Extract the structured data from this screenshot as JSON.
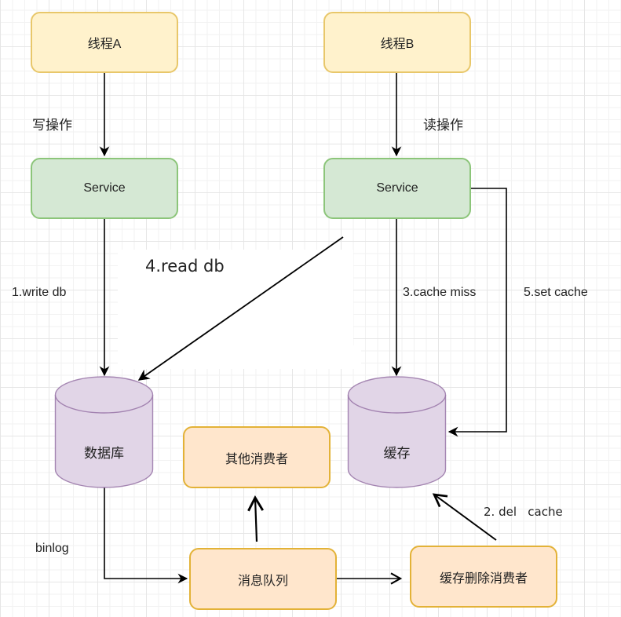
{
  "nodes": {
    "thread_a": "线程A",
    "thread_b": "线程B",
    "service_a": "Service",
    "service_b": "Service",
    "database": "数据库",
    "cache": "缓存",
    "other_consumers": "其他消费者",
    "message_queue": "消息队列",
    "cache_delete_consumer": "缓存删除消费者"
  },
  "edge_labels": {
    "write_op": "写操作",
    "read_op": "读操作",
    "write_db": "1.write db",
    "read_db": "4.read db",
    "cache_miss": "3.cache miss",
    "set_cache": "5.set cache",
    "binlog": "binlog",
    "del_cache": "2. del   cache"
  },
  "colors": {
    "thread_fill": "#fff2cc",
    "service_fill": "#d5e8d4",
    "storage_fill": "#e1d5e7",
    "consumer_fill": "#ffe6cc",
    "edge": "#000000"
  }
}
